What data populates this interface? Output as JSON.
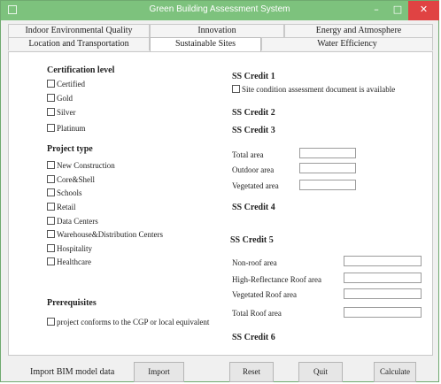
{
  "window": {
    "title": "Green Building Assessment System"
  },
  "tabs_row1": [
    "Indoor Environmental Quality",
    "Innovation",
    "Energy and Atmosphere"
  ],
  "tabs_row2": [
    "Location and Transportation",
    "Sustainable Sites",
    "Water Efficiency"
  ],
  "certification": {
    "heading": "Certification level",
    "options": [
      "Certified",
      "Gold",
      "Silver",
      "Platinum"
    ]
  },
  "project_type": {
    "heading": "Project type",
    "options": [
      "New Construction",
      "Core&Shell",
      "Schools",
      "Retail",
      "Data Centers",
      "Warehouse&Distribution Centers",
      "Hospitality",
      "Healthcare"
    ]
  },
  "prerequisites": {
    "heading": "Prerequisites",
    "option": "project conforms to the CGP or local equivalent"
  },
  "ss_credit1": {
    "heading": "SS Credit 1",
    "option": "Site condition assessment document is available"
  },
  "ss_credit2": {
    "heading": "SS Credit 2"
  },
  "ss_credit3": {
    "heading": "SS Credit 3",
    "fields": [
      "Total area",
      "Outdoor area",
      "Vegetated area"
    ]
  },
  "ss_credit4": {
    "heading": "SS Credit 4"
  },
  "ss_credit5": {
    "heading": "SS Credit 5",
    "fields": [
      "Non-roof area",
      "High-Reflectance Roof area",
      "Vegetated Roof area",
      "Total Roof area"
    ]
  },
  "ss_credit6": {
    "heading": "SS Credit 6"
  },
  "bottom": {
    "import_label": "Import BIM model data",
    "import_button": "Import",
    "reset_button": "Reset",
    "quit_button": "Quit",
    "calculate_button": "Calculate"
  }
}
